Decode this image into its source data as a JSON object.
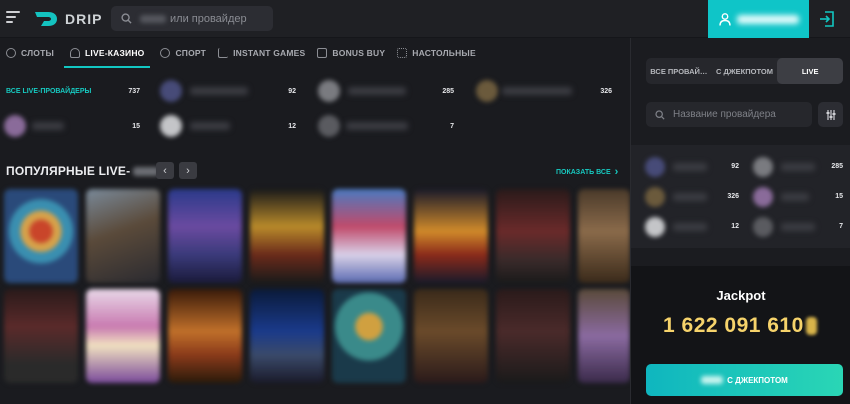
{
  "header": {
    "logo_text": "DRIP",
    "search_placeholder_suffix": "или провайдер"
  },
  "nav": {
    "tabs": [
      {
        "label": "СЛОТЫ",
        "icon": "slots-icon",
        "active": false
      },
      {
        "label": "LIVE-КАЗИНО",
        "icon": "live-casino-icon",
        "active": true
      },
      {
        "label": "СПОРТ",
        "icon": "sport-icon",
        "active": false
      },
      {
        "label": "INSTANT GAMES",
        "icon": "instant-games-icon",
        "active": false
      },
      {
        "label": "BONUS BUY",
        "icon": "bonus-buy-icon",
        "active": false
      },
      {
        "label": "НАСТОЛЬНЫЕ",
        "icon": "table-games-icon",
        "active": false
      }
    ]
  },
  "providers": {
    "all_label": "ВСЕ LIVE-ПРОВАЙДЕРЫ",
    "all_count": "737",
    "counts": [
      "92",
      "285",
      "326",
      "15",
      "12",
      "7"
    ]
  },
  "popular": {
    "title_prefix": "ПОПУЛЯРНЫЕ LIVE-",
    "prev": "‹",
    "next": "›",
    "show_all": "ПОКАЗАТЬ ВСЕ",
    "show_all_arrow": "›"
  },
  "sidebar": {
    "segments": [
      {
        "label": "ВСЕ ПРОВАЙ…",
        "active": false
      },
      {
        "label": "С ДЖЕКПОТОМ",
        "active": false
      },
      {
        "label": "LIVE",
        "active": true
      }
    ],
    "search_placeholder": "Название провайдера",
    "provider_counts": [
      "92",
      "285",
      "326",
      "15",
      "12",
      "7"
    ]
  },
  "jackpot": {
    "title": "Jackpot",
    "amount": "1 622 091 610",
    "button_suffix": "С ДЖЕКПОТОМ"
  },
  "colors": {
    "accent": "#12c7c2",
    "jackpot_gold": "#f6d36b",
    "user_button": "#0fc5c8"
  }
}
